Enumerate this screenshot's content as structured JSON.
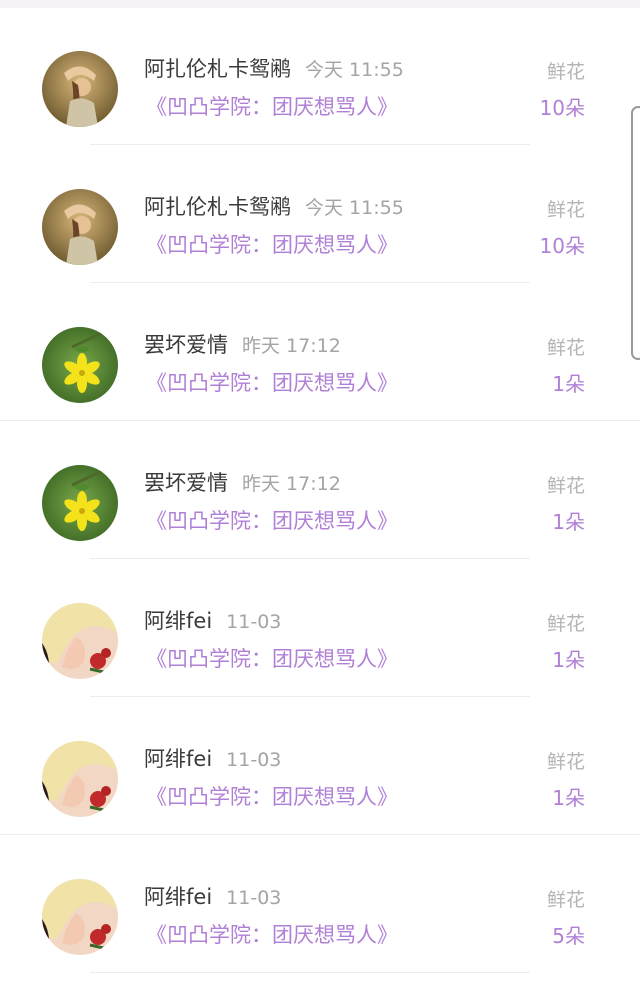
{
  "list": {
    "items": [
      {
        "name": "阿扎伦札卡鸳鹇",
        "time": "今天 11:55",
        "title": "《凹凸学院：团厌想骂人》",
        "gift_label": "鲜花",
        "gift_count": "10朵",
        "avatar_icon": "girl-avatar-icon"
      },
      {
        "name": "阿扎伦札卡鸳鹇",
        "time": "今天 11:55",
        "title": "《凹凸学院：团厌想骂人》",
        "gift_label": "鲜花",
        "gift_count": "10朵",
        "avatar_icon": "girl-avatar-icon"
      },
      {
        "name": "罢坏爱情",
        "time": "昨天 17:12",
        "title": "《凹凸学院：团厌想骂人》",
        "gift_label": "鲜花",
        "gift_count": "1朵",
        "avatar_icon": "yellow-flower-avatar-icon"
      },
      {
        "name": "罢坏爱情",
        "time": "昨天 17:12",
        "title": "《凹凸学院：团厌想骂人》",
        "gift_label": "鲜花",
        "gift_count": "1朵",
        "avatar_icon": "yellow-flower-avatar-icon"
      },
      {
        "name": "阿绯fei",
        "time": "11-03",
        "title": "《凹凸学院：团厌想骂人》",
        "gift_label": "鲜花",
        "gift_count": "1朵",
        "avatar_icon": "anime-boy-avatar-icon"
      },
      {
        "name": "阿绯fei",
        "time": "11-03",
        "title": "《凹凸学院：团厌想骂人》",
        "gift_label": "鲜花",
        "gift_count": "1朵",
        "avatar_icon": "anime-boy-avatar-icon"
      },
      {
        "name": "阿绯fei",
        "time": "11-03",
        "title": "《凹凸学院：团厌想骂人》",
        "gift_label": "鲜花",
        "gift_count": "5朵",
        "avatar_icon": "anime-boy-avatar-icon"
      }
    ]
  },
  "colors": {
    "accent_purple": "#b07fd6",
    "name_text": "#3a3a3a",
    "secondary_text": "#a4a4a4"
  }
}
